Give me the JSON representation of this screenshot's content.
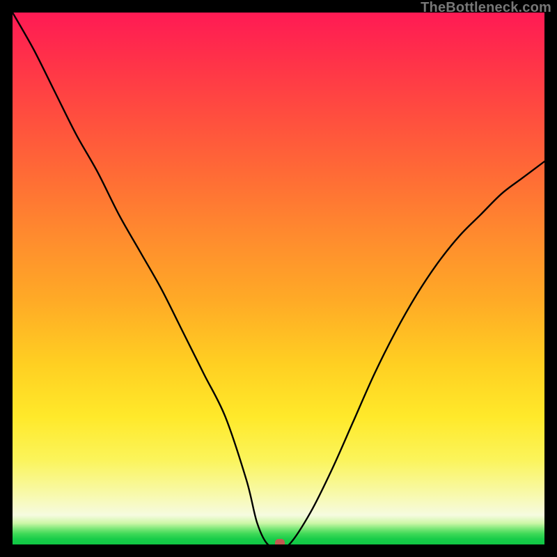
{
  "watermark": "TheBottleneck.com",
  "chart_data": {
    "type": "line",
    "title": "",
    "xlabel": "",
    "ylabel": "",
    "xlim": [
      0,
      100
    ],
    "ylim": [
      0,
      100
    ],
    "grid": false,
    "legend": false,
    "series": [
      {
        "name": "bottleneck-curve",
        "x": [
          0,
          4,
          8,
          12,
          16,
          20,
          24,
          28,
          32,
          36,
          40,
          44,
          46,
          48,
          50,
          52,
          56,
          60,
          64,
          68,
          72,
          76,
          80,
          84,
          88,
          92,
          96,
          100
        ],
        "values": [
          100,
          93,
          85,
          77,
          70,
          62,
          55,
          48,
          40,
          32,
          24,
          12,
          4,
          0,
          0,
          0,
          6,
          14,
          23,
          32,
          40,
          47,
          53,
          58,
          62,
          66,
          69,
          72
        ]
      }
    ],
    "marker": {
      "x": 50.3,
      "y": 0.2,
      "color": "#c05a50"
    },
    "background": {
      "gradient_stops": [
        {
          "pos": 0.0,
          "color": "#ff1a54"
        },
        {
          "pos": 0.3,
          "color": "#ff6a36"
        },
        {
          "pos": 0.6,
          "color": "#ffcf22"
        },
        {
          "pos": 0.85,
          "color": "#f8f9a4"
        },
        {
          "pos": 0.97,
          "color": "#7fe87a"
        },
        {
          "pos": 1.0,
          "color": "#10c844"
        }
      ]
    }
  }
}
